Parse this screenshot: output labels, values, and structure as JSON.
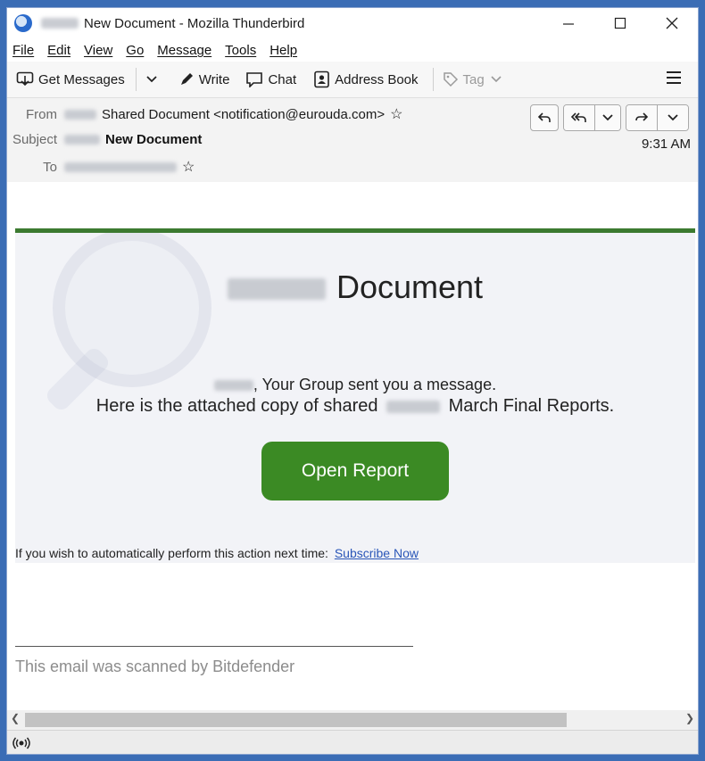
{
  "window": {
    "title": "New Document - Mozilla Thunderbird"
  },
  "menu": {
    "items": [
      "File",
      "Edit",
      "View",
      "Go",
      "Message",
      "Tools",
      "Help"
    ]
  },
  "toolbar": {
    "get_messages": "Get Messages",
    "write": "Write",
    "chat": "Chat",
    "address_book": "Address Book",
    "tag": "Tag"
  },
  "header": {
    "from_label": "From",
    "from_value": "Shared Document <notification@eurouda.com>",
    "subject_label": "Subject",
    "subject_value": "New Document",
    "to_label": "To",
    "time": "9:31 AM"
  },
  "email": {
    "title": "Document",
    "line1": ", Your Group sent you a message.",
    "line2_pre": "Here is the attached copy of shared",
    "line2_post": "March Final Reports.",
    "button": "Open Report",
    "auto_text": "If you wish to automatically perform this action next time:",
    "auto_link": "Subscribe Now",
    "scanned": "This email was scanned by Bitdefender"
  },
  "colors": {
    "accent_green": "#3c7a30",
    "button_green": "#3b8a24",
    "link": "#2a56b8"
  }
}
